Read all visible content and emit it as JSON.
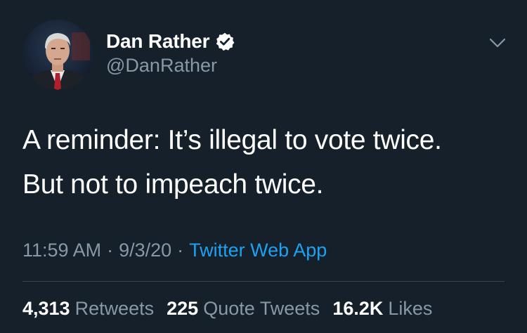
{
  "tweet": {
    "author": {
      "display_name": "Dan Rather",
      "handle": "@DanRather",
      "verified": true,
      "avatar_icon": "profile-photo"
    },
    "text_lines": [
      "A reminder: It’s illegal to vote twice.",
      "But not to impeach twice."
    ],
    "meta": {
      "time": "11:59 AM",
      "separator": "·",
      "date": "9/3/20",
      "source": "Twitter Web App"
    },
    "stats": [
      {
        "count": "4,313",
        "label": "Retweets"
      },
      {
        "count": "225",
        "label": "Quote Tweets"
      },
      {
        "count": "16.2K",
        "label": "Likes"
      }
    ]
  },
  "colors": {
    "background": "#15202b",
    "primary_text": "#ffffff",
    "secondary_text": "#8899a6",
    "link": "#1da1f2",
    "divider": "#38444d"
  },
  "icons": {
    "verified": "verified-badge-icon",
    "more": "chevron-down-icon"
  }
}
